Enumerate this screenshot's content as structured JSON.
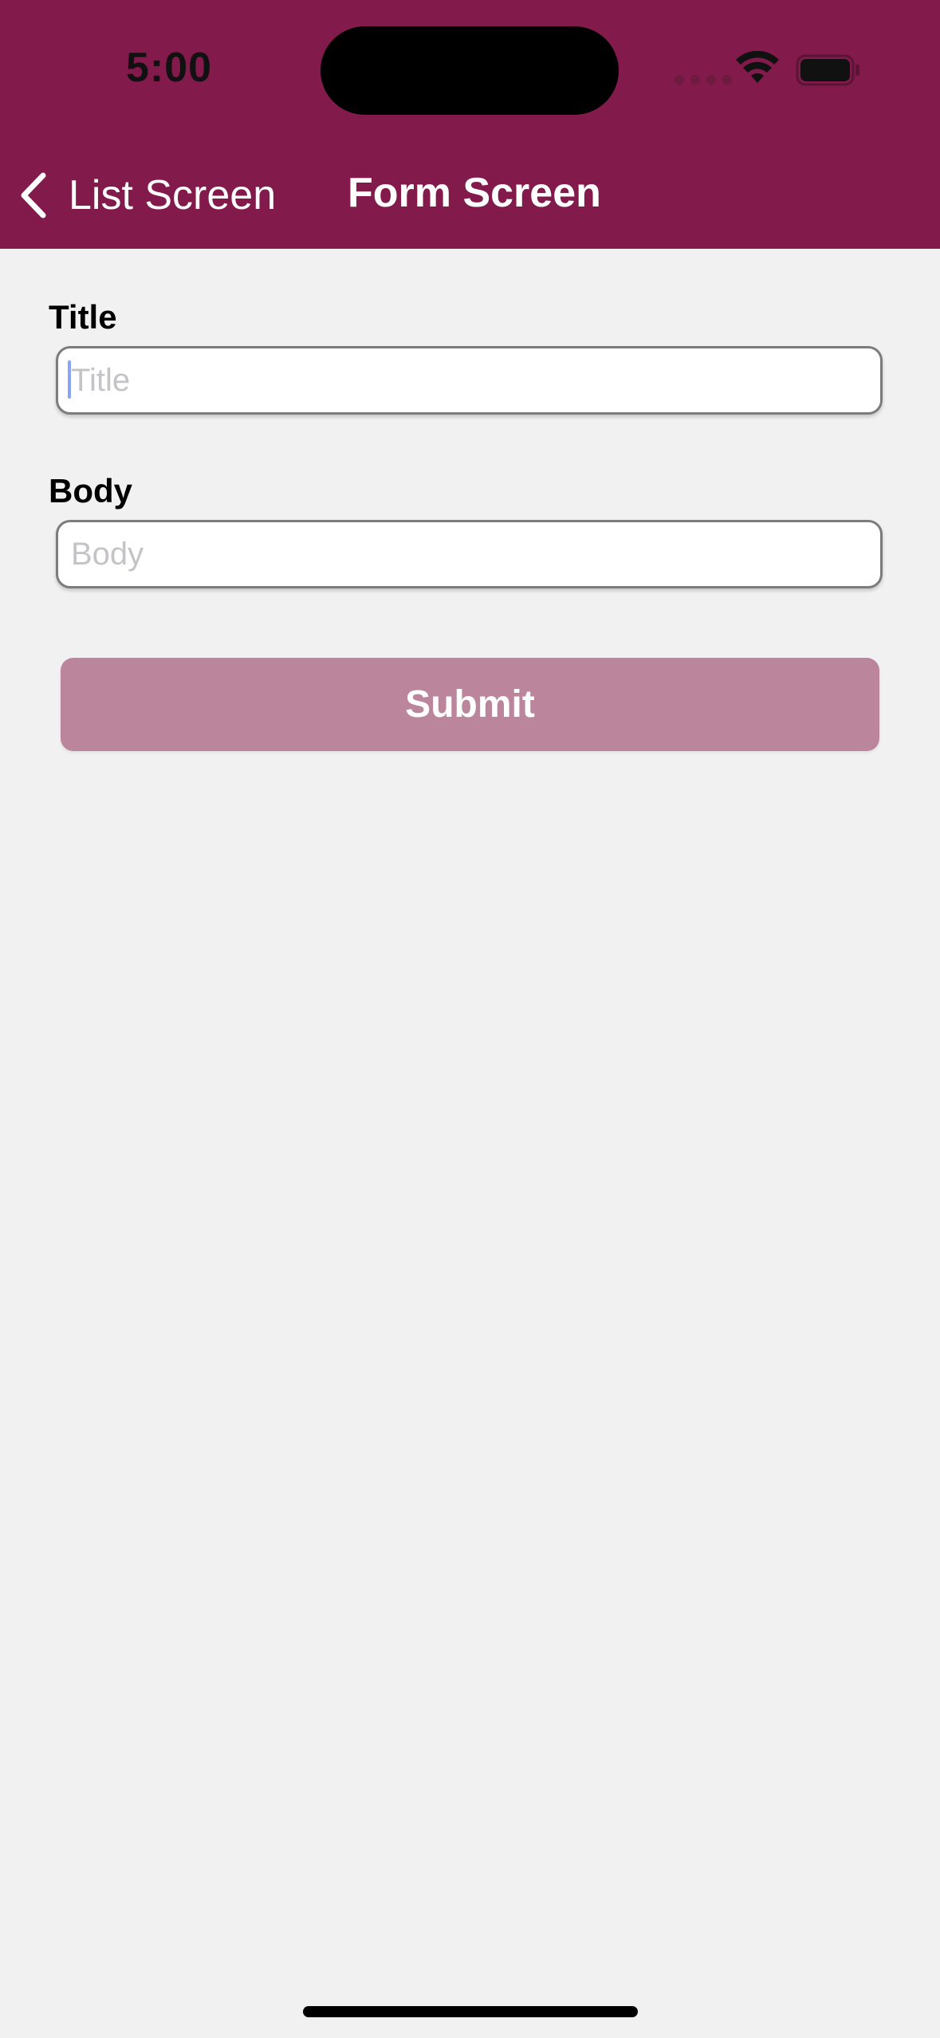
{
  "status_bar": {
    "time": "5:00",
    "icons": [
      "signal-icon",
      "wifi-icon",
      "battery-icon"
    ]
  },
  "nav": {
    "back_label": "List Screen",
    "title": "Form Screen",
    "back_icon": "chevron-left-icon"
  },
  "form": {
    "title_label": "Title",
    "title_placeholder": "Title",
    "title_value": "",
    "body_label": "Body",
    "body_placeholder": "Body",
    "body_value": "",
    "submit_label": "Submit"
  },
  "colors": {
    "header": "#821a4b",
    "background": "#f2f1f2",
    "submit_disabled": "#bb869c",
    "caret": "#8aa3f7"
  }
}
